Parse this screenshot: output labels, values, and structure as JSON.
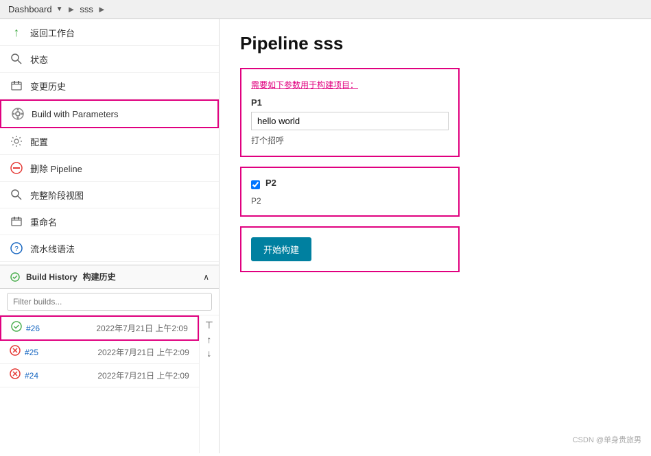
{
  "breadcrumb": {
    "items": [
      {
        "label": "Dashboard",
        "href": "#"
      },
      {
        "label": "sss",
        "href": "#"
      }
    ],
    "separator": "►"
  },
  "sidebar": {
    "items": [
      {
        "id": "return-workspace",
        "label": "返回工作台",
        "icon": "return-icon"
      },
      {
        "id": "status",
        "label": "状态",
        "icon": "search-icon"
      },
      {
        "id": "change-history",
        "label": "变更历史",
        "icon": "history-icon"
      },
      {
        "id": "build-with-parameters",
        "label": "Build with Parameters",
        "icon": "build-icon",
        "highlighted": true
      },
      {
        "id": "config",
        "label": "配置",
        "icon": "config-icon"
      },
      {
        "id": "delete-pipeline",
        "label": "删除 Pipeline",
        "icon": "delete-icon"
      },
      {
        "id": "full-stage-view",
        "label": "完整阶段视图",
        "icon": "stages-icon"
      },
      {
        "id": "rename",
        "label": "重命名",
        "icon": "rename-icon"
      },
      {
        "id": "pipeline-syntax",
        "label": "流水线语法",
        "icon": "pipeline-icon"
      }
    ]
  },
  "build_history": {
    "title": "Build History",
    "title_cn": "构建历史",
    "filter_placeholder": "Filter builds...",
    "chevron": "∧",
    "items": [
      {
        "id": "build-26",
        "num": "#26",
        "date": "2022年7月21日 上午2:09",
        "status": "success",
        "active": true
      },
      {
        "id": "build-25",
        "num": "#25",
        "date": "2022年7月21日 上午2:09",
        "status": "error"
      },
      {
        "id": "build-24",
        "num": "#24",
        "date": "2022年7月21日 上午2:09",
        "status": "error"
      }
    ]
  },
  "main": {
    "title": "Pipeline sss",
    "param_hint": "需要如下参数用于构建项目：",
    "p1_label": "P1",
    "p1_value": "hello world",
    "p1_desc": "打个招呼",
    "p2_label": "P2",
    "p2_checked": true,
    "p2_desc": "P2",
    "build_button_label": "开始构建"
  },
  "watermark": "CSDN @单身贵旅男"
}
